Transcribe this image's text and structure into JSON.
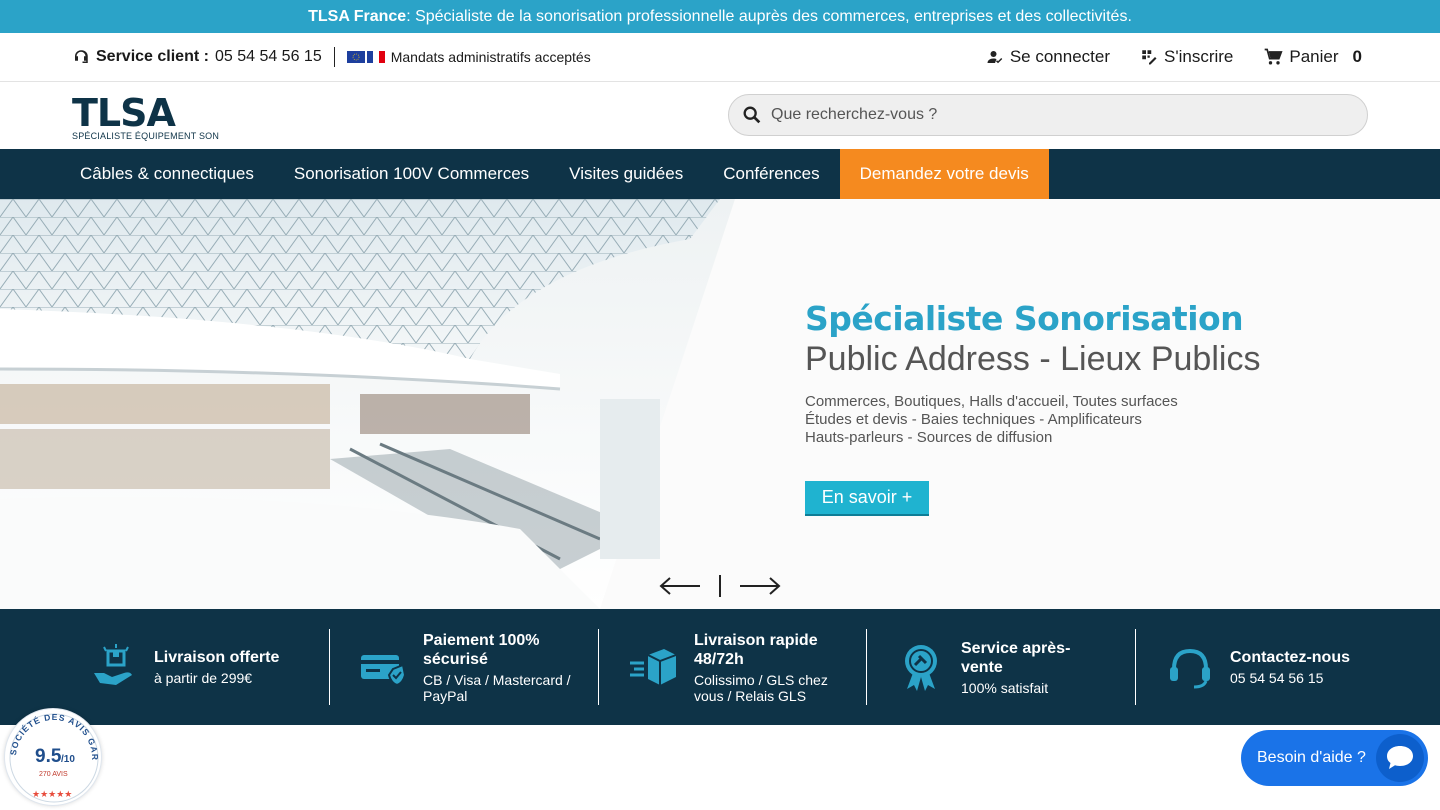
{
  "topbar": {
    "brand": "TLSA France",
    "text": " : Spécialiste de la sonorisation professionnelle auprès des commerces, entreprises et des collectivités."
  },
  "utility": {
    "service_label": "Service client :",
    "service_phone": "05 54 54 56 15",
    "mandats": "Mandats administratifs acceptés",
    "login": "Se connecter",
    "register": "S'inscrire",
    "cart_label": "Panier",
    "cart_count": "0"
  },
  "header": {
    "logo_title": "TLSA",
    "logo_subtitle": "SPÉCIALISTE ÉQUIPEMENT SON",
    "search_placeholder": "Que recherchez-vous ?"
  },
  "nav": {
    "items": [
      "Câbles & connectiques",
      "Sonorisation 100V Commerces",
      "Visites guidées",
      "Conférences",
      "Demandez votre devis"
    ]
  },
  "hero": {
    "title": "Spécialiste Sonorisation",
    "subtitle": "Public Address - Lieux Publics",
    "lines": [
      "Commerces, Boutiques, Halls d'accueil, Toutes surfaces",
      "Études et devis - Baies techniques - Amplificateurs",
      "Hauts-parleurs - Sources de diffusion"
    ],
    "button": "En savoir +"
  },
  "features": [
    {
      "title": "Livraison offerte",
      "subtitle": "à partir de 299€",
      "icon": "delivery-hand-icon"
    },
    {
      "title": "Paiement 100% sécurisé",
      "subtitle": "CB / Visa / Mastercard / PayPal",
      "icon": "secure-card-icon"
    },
    {
      "title": "Livraison rapide 48/72h",
      "subtitle": "Colissimo / GLS chez vous / Relais GLS",
      "icon": "fast-box-icon"
    },
    {
      "title": "Service après-vente",
      "subtitle": "100% satisfait",
      "icon": "award-badge-icon"
    },
    {
      "title": "Contactez-nous",
      "subtitle": "05 54 54 56 15",
      "icon": "headset-icon"
    }
  ],
  "rating": {
    "score": "9.5",
    "scale": "/10",
    "count": "270 AVIS",
    "ring_text": "SOCIÉTÉ DES AVIS GARANTIS"
  },
  "help": {
    "label": "Besoin d'aide ?"
  },
  "colors": {
    "topbar": "#2ba3c8",
    "navy": "#0e3347",
    "cta": "#f58a1f",
    "chat": "#1a73e8"
  }
}
